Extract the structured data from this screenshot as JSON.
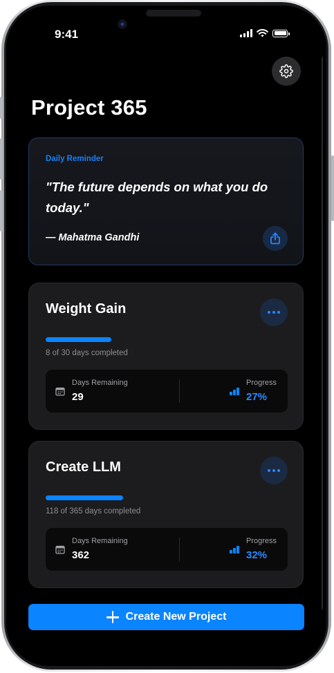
{
  "status_bar": {
    "time": "9:41"
  },
  "header": {
    "title": "Project 365"
  },
  "reminder": {
    "label": "Daily Reminder",
    "quote": "\"The future depends on what you do today.\"",
    "author": "— Mahatma Gandhi"
  },
  "projects": [
    {
      "title": "Weight Gain",
      "completed_text": "8 of 30 days completed",
      "progress_fraction": 0.27,
      "days_remaining_label": "Days Remaining",
      "days_remaining": "29",
      "progress_label": "Progress",
      "progress_text": "27%"
    },
    {
      "title": "Create LLM",
      "completed_text": "118 of 365 days completed",
      "progress_fraction": 0.32,
      "days_remaining_label": "Days Remaining",
      "days_remaining": "362",
      "progress_label": "Progress",
      "progress_text": "32%"
    }
  ],
  "create_button": {
    "label": "Create New Project"
  },
  "colors": {
    "accent": "#0a84ff",
    "background": "#000000",
    "card": "#1c1c1e"
  },
  "icons": [
    "settings-gear-icon",
    "share-icon",
    "more-dots-icon",
    "calendar-icon",
    "bar-chart-icon",
    "plus-icon"
  ]
}
